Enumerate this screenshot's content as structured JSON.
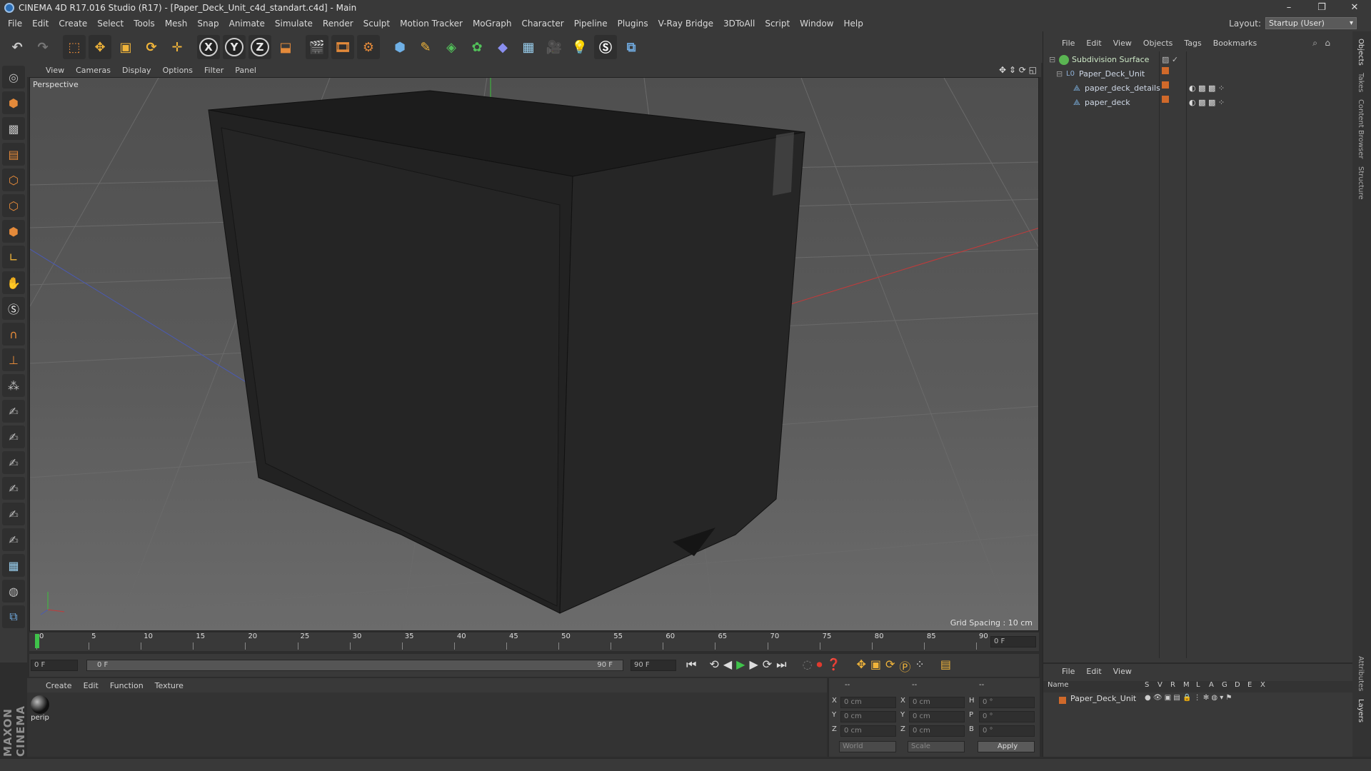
{
  "window": {
    "title": "CINEMA 4D R17.016 Studio (R17) - [Paper_Deck_Unit_c4d_standart.c4d] - Main",
    "minimize": "–",
    "restore": "❐",
    "close": "✕"
  },
  "menu": [
    "File",
    "Edit",
    "Create",
    "Select",
    "Tools",
    "Mesh",
    "Snap",
    "Animate",
    "Simulate",
    "Render",
    "Sculpt",
    "Motion Tracker",
    "MoGraph",
    "Character",
    "Pipeline",
    "Plugins",
    "V-Ray Bridge",
    "3DToAll",
    "Script",
    "Window",
    "Help"
  ],
  "layout": {
    "label": "Layout:",
    "value": "Startup (User)"
  },
  "toolbar": {
    "axis_x": "X",
    "axis_y": "Y",
    "axis_z": "Z"
  },
  "viewport": {
    "menu": [
      "View",
      "Cameras",
      "Display",
      "Options",
      "Filter",
      "Panel"
    ],
    "label": "Perspective",
    "grid_spacing": "Grid Spacing : 10 cm"
  },
  "timeline": {
    "ticks": [
      "0",
      "5",
      "10",
      "15",
      "20",
      "25",
      "30",
      "35",
      "40",
      "45",
      "50",
      "55",
      "60",
      "65",
      "70",
      "75",
      "80",
      "85",
      "90"
    ],
    "current_frame": "0 F",
    "start_field": "0 F",
    "range_start": "0 F",
    "range_end": "90 F",
    "end_field": "90 F"
  },
  "material_manager": {
    "menu": [
      "Create",
      "Edit",
      "Function",
      "Texture"
    ],
    "materials": [
      {
        "name": "perip"
      }
    ]
  },
  "coordinates": {
    "header": [
      "--",
      "--",
      "--"
    ],
    "rows": [
      {
        "a": "X",
        "av": "0 cm",
        "b": "X",
        "bv": "0 cm",
        "c": "H",
        "cv": "0 °"
      },
      {
        "a": "Y",
        "av": "0 cm",
        "b": "Y",
        "bv": "0 cm",
        "c": "P",
        "cv": "0 °"
      },
      {
        "a": "Z",
        "av": "0 cm",
        "b": "Z",
        "bv": "0 cm",
        "c": "B",
        "cv": "0 °"
      }
    ],
    "world": "World",
    "scale": "Scale",
    "apply": "Apply"
  },
  "objects_panel": {
    "menu": [
      "File",
      "Edit",
      "View",
      "Objects",
      "Tags",
      "Bookmarks"
    ],
    "items": [
      {
        "name": "Subdivision Surface",
        "indent": 0,
        "color": "#5ab552"
      },
      {
        "name": "Paper_Deck_Unit",
        "indent": 1,
        "color": "#8fb0d6"
      },
      {
        "name": "paper_deck_details",
        "indent": 2,
        "color": "#7fb7e8"
      },
      {
        "name": "paper_deck",
        "indent": 2,
        "color": "#7fb7e8"
      }
    ]
  },
  "layers_panel": {
    "menu": [
      "File",
      "Edit",
      "View"
    ],
    "columns": [
      "Name",
      "S",
      "V",
      "R",
      "M",
      "L",
      "A",
      "G",
      "D",
      "E",
      "X"
    ],
    "rows": [
      {
        "name": "Paper_Deck_Unit"
      }
    ]
  },
  "side_tabs": [
    "Objects",
    "Takes",
    "Content Browser",
    "Structure",
    "Attributes",
    "Layers"
  ],
  "brand": "MAXON CINEMA 4D",
  "colors": {
    "accent_orange": "#d0692a",
    "play_green": "#3fc24a",
    "record_red": "#e03a2e"
  }
}
